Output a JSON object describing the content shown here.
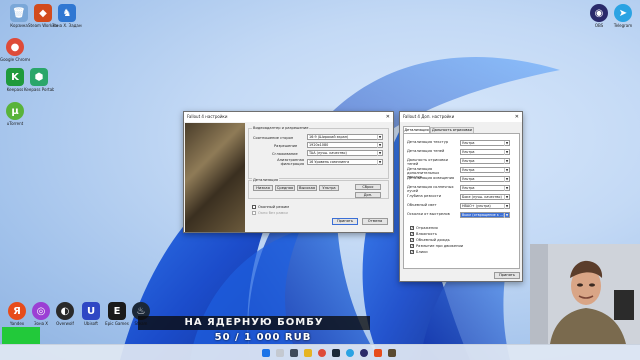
{
  "desktop": {
    "icons": [
      {
        "label": "Корзина",
        "color": "#7aa7d8",
        "glyph": "🗑"
      },
      {
        "label": "Steam Workshop",
        "color": "#d24b1d",
        "glyph": "◆"
      },
      {
        "label": "Зона Х. Задание",
        "color": "#2f77d2",
        "glyph": "♞"
      },
      {
        "label": "Google Chrome",
        "color": "#de4b39",
        "glyph": "●"
      },
      {
        "label": "Keepass",
        "color": "#1f9a3c",
        "glyph": "K"
      },
      {
        "label": "Keepass Portable",
        "color": "#2aa66a",
        "glyph": "⬢"
      },
      {
        "label": "uTorrent",
        "color": "#59b33b",
        "glyph": "µ"
      },
      {
        "label": "OBS",
        "color": "#2a2a6a",
        "glyph": "◉"
      },
      {
        "label": "Telegram",
        "color": "#2ba3e3",
        "glyph": "➤"
      }
    ],
    "bottom_icons": [
      {
        "label": "Yandex",
        "color": "#e74c1b",
        "glyph": "Я"
      },
      {
        "label": "Зона Х",
        "color": "#9b3fd4",
        "glyph": "◎"
      },
      {
        "label": "Overwolf",
        "color": "#2a2a2a",
        "glyph": "◐"
      },
      {
        "label": "Ubisoft",
        "color": "#2f47c4",
        "glyph": "U"
      },
      {
        "label": "Epic Games",
        "color": "#1a1a1a",
        "glyph": "E"
      },
      {
        "label": "Steam",
        "color": "#1b2838",
        "glyph": "♨"
      }
    ]
  },
  "fo_settings": {
    "title": "Fallout 4 настройки",
    "close": "✕",
    "group_display": "Видеоадаптер и разрешение",
    "aspect_label": "Соотношение сторон",
    "aspect_value": "16:9 (Широкий экран)",
    "resolution_label": "Разрешение",
    "resolution_value": "1920x1080",
    "aa_label": "Сглаживание",
    "aa_value": "TAA (лучш. качество)",
    "af_label": "Анизотропная фильтрация",
    "af_value": "16 Уровень самплинга",
    "group_detail": "Детализация",
    "btn_low": "Низкая",
    "btn_medium": "Средняя",
    "btn_high": "Высокая",
    "btn_ultra": "Ультра",
    "btn_reset": "Сброс",
    "btn_advanced": "Доп.",
    "windowed_label": "Оконный режим",
    "borderless_label": "Окно без рамки",
    "btn_apply": "Принять",
    "btn_cancel": "Отмена"
  },
  "fo_advanced": {
    "title": "Fallout 4 Доп. настройки",
    "close": "✕",
    "tab_detail": "Детализация",
    "tab_distance": "Дальность отрисовки",
    "rows": [
      {
        "label": "Детализация текстур",
        "value": "Ультра"
      },
      {
        "label": "Детализация теней",
        "value": "Ультра"
      },
      {
        "label": "Дальность отрисовки теней",
        "value": "Ультра"
      },
      {
        "label": "Детализация дополнительных текстур",
        "value": "Ультра"
      },
      {
        "label": "Детализация освещения",
        "value": "Ультра"
      },
      {
        "label": "Детализация солнечных лучей",
        "value": "Ультра"
      },
      {
        "label": "Глубина резкости",
        "value": "Боке (лучш. качество)"
      },
      {
        "label": "Объемный свет",
        "value": "HBAO+ (ультра)"
      },
      {
        "label": "Осколки от выстрелов",
        "value": "Выкл (отвращение к ...)"
      }
    ],
    "checks": [
      {
        "label": "Отражения",
        "checked": true
      },
      {
        "label": "Влажность",
        "checked": true
      },
      {
        "label": "Объемный дождь",
        "checked": true
      },
      {
        "label": "Размытие при движении",
        "checked": true
      },
      {
        "label": "Блики",
        "checked": true
      }
    ],
    "btn_apply": "Принять"
  },
  "stream_overlay": {
    "banner_title": "НА ЯДЕРНУЮ БОМБУ",
    "banner_goal": "50 / 1 000 RUB"
  },
  "colors": {
    "accent": "#3b6fd6",
    "taskbar": "#e1e8f3",
    "overlay_bg": "#0a0a0a",
    "stream_green": "#22c93a"
  }
}
